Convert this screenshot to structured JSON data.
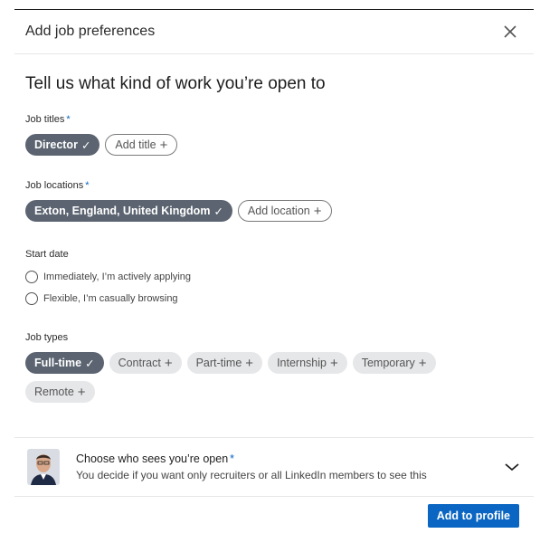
{
  "modal": {
    "title": "Add job preferences",
    "headline": "Tell us what kind of work you’re open to"
  },
  "job_titles": {
    "label": "Job titles",
    "required_mark": "*",
    "selected": [
      "Director"
    ],
    "add_label": "Add title"
  },
  "job_locations": {
    "label": "Job locations",
    "required_mark": "*",
    "selected": [
      "Exton, England, United Kingdom"
    ],
    "add_label": "Add location"
  },
  "start_date": {
    "label": "Start date",
    "options": [
      "Immediately, I’m actively applying",
      "Flexible, I’m casually browsing"
    ]
  },
  "job_types": {
    "label": "Job types",
    "selected": [
      "Full-time"
    ],
    "options": [
      "Contract",
      "Part-time",
      "Internship",
      "Temporary",
      "Remote"
    ]
  },
  "visibility": {
    "title": "Choose who sees you’re open",
    "required_mark": "*",
    "subtitle": "You decide if you want only recruiters or all LinkedIn members to see this"
  },
  "footer": {
    "submit_label": "Add to profile"
  },
  "glyphs": {
    "check": "✓",
    "plus": "+"
  },
  "colors": {
    "accent": "#0a66c2",
    "chip_selected": "#5b6470",
    "chip_grey": "#e6e7e9"
  },
  "icons": {
    "close": "close-icon",
    "check": "check-icon",
    "plus": "plus-icon",
    "chevron": "chevron-down-icon"
  }
}
